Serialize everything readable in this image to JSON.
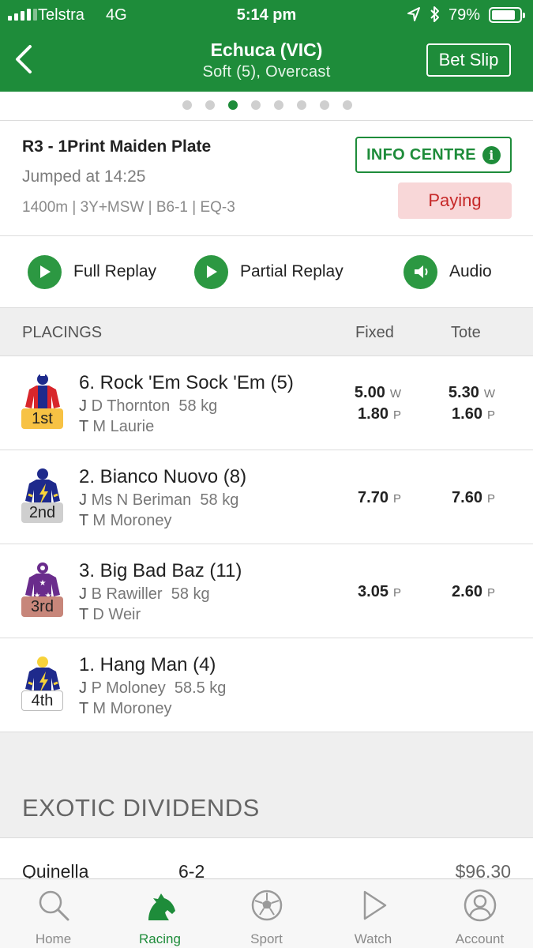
{
  "status_bar": {
    "carrier": "Telstra",
    "network": "4G",
    "time": "5:14 pm",
    "battery": "79%"
  },
  "header": {
    "title": "Echuca (VIC)",
    "subtitle": "Soft (5), Overcast",
    "bet_slip": "Bet Slip"
  },
  "pager": {
    "count": 8,
    "active_index": 2
  },
  "race": {
    "title": "R3 - 1Print Maiden Plate",
    "jumped": "Jumped at 14:25",
    "meta": "1400m | 3Y+MSW | B6-1 | EQ-3",
    "info_centre": "INFO CENTRE",
    "status": "Paying"
  },
  "replay": {
    "full": "Full Replay",
    "partial": "Partial Replay",
    "audio": "Audio"
  },
  "placings": {
    "heading": "PLACINGS",
    "fixed": "Fixed",
    "tote": "Tote",
    "runners": [
      {
        "name": "6. Rock 'Em Sock 'Em (5)",
        "jockey": "D Thornton",
        "weight": "58 kg",
        "trainer": "M Laurie",
        "place": "1st",
        "fixed_w": "5.00",
        "fixed_p": "1.80",
        "tote_w": "5.30",
        "tote_p": "1.60"
      },
      {
        "name": "2. Bianco Nuovo (8)",
        "jockey": "Ms N Beriman",
        "weight": "58 kg",
        "trainer": "M Moroney",
        "place": "2nd",
        "fixed_p": "7.70",
        "tote_p": "7.60"
      },
      {
        "name": "3. Big Bad Baz (11)",
        "jockey": "B Rawiller",
        "weight": "58 kg",
        "trainer": "D Weir",
        "place": "3rd",
        "fixed_p": "3.05",
        "tote_p": "2.60"
      },
      {
        "name": "1. Hang Man (4)",
        "jockey": "P Moloney",
        "weight": "58.5 kg",
        "trainer": "M Moroney",
        "place": "4th"
      }
    ],
    "labels": {
      "jockey_prefix": "J",
      "trainer_prefix": "T",
      "win": "W",
      "place": "P"
    }
  },
  "exotics": {
    "heading": "EXOTIC DIVIDENDS",
    "rows": [
      {
        "type": "Quinella",
        "combo": "6-2",
        "dividend": "$96.30"
      }
    ]
  },
  "tabbar": {
    "items": [
      {
        "label": "Home",
        "icon": "search-icon"
      },
      {
        "label": "Racing",
        "icon": "horse-head-icon"
      },
      {
        "label": "Sport",
        "icon": "soccer-ball-icon"
      },
      {
        "label": "Watch",
        "icon": "play-outline-icon"
      },
      {
        "label": "Account",
        "icon": "user-icon"
      }
    ],
    "active": "Racing"
  },
  "colors": {
    "brand_green": "#1e8c3a",
    "paying_bg": "#f8d7d8",
    "paying_text": "#c62828",
    "first_badge": "#f7c244",
    "second_badge": "#cfcfcf",
    "third_badge": "#c7867a"
  }
}
